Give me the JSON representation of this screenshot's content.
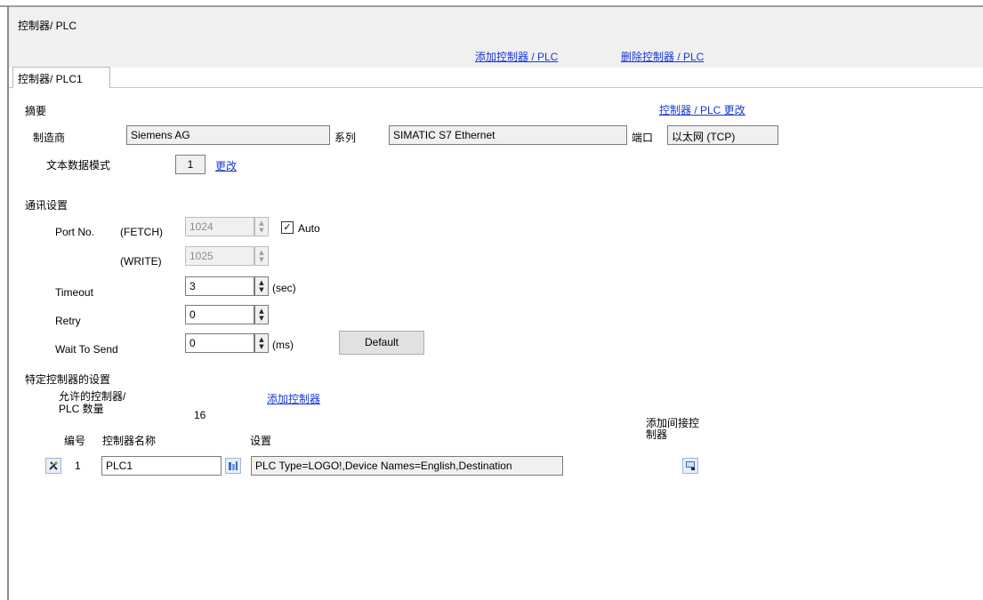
{
  "header": {
    "title": "控制器/ PLC",
    "add_link": "添加控制器 / PLC",
    "delete_link": "删除控制器 / PLC"
  },
  "tab": {
    "label": "控制器/ PLC1"
  },
  "summary": {
    "heading": "摘要",
    "change_link": "控制器 / PLC 更改",
    "manufacturer_label": "制造商",
    "manufacturer_value": "Siemens AG",
    "series_label": "系列",
    "series_value": "SIMATIC S7 Ethernet",
    "port_label": "端口",
    "port_value": "以太网 (TCP)",
    "text_mode_label": "文本数据模式",
    "text_mode_value": "1",
    "text_mode_change": "更改"
  },
  "comm": {
    "heading": "通讯设置",
    "port_no_label": "Port No.",
    "fetch_label": "(FETCH)",
    "fetch_value": "1024",
    "auto_label": "Auto",
    "auto_checked": true,
    "write_label": "(WRITE)",
    "write_value": "1025",
    "timeout_label": "Timeout",
    "timeout_value": "3",
    "timeout_unit": "(sec)",
    "retry_label": "Retry",
    "retry_value": "0",
    "wait_label": "Wait To Send",
    "wait_value": "0",
    "wait_unit": "(ms)",
    "default_button": "Default"
  },
  "specific": {
    "heading": "特定控制器的设置",
    "allowed_label_line1": "允许的控制器/",
    "allowed_label_line2": "PLC 数量",
    "allowed_value": "16",
    "add_controller_link": "添加控制器",
    "col_number": "编号",
    "col_name": "控制器名称",
    "col_settings": "设置",
    "col_add_indirect_line1": "添加间接控",
    "col_add_indirect_line2": "制器",
    "rows": [
      {
        "number": "1",
        "name": "PLC1",
        "settings": "PLC Type=LOGO!,Device Names=English,Destination"
      }
    ]
  },
  "colors": {
    "link": "#1a37d6",
    "header_bg": "#f0f0f0",
    "field_bg": "#f0f0f0"
  }
}
